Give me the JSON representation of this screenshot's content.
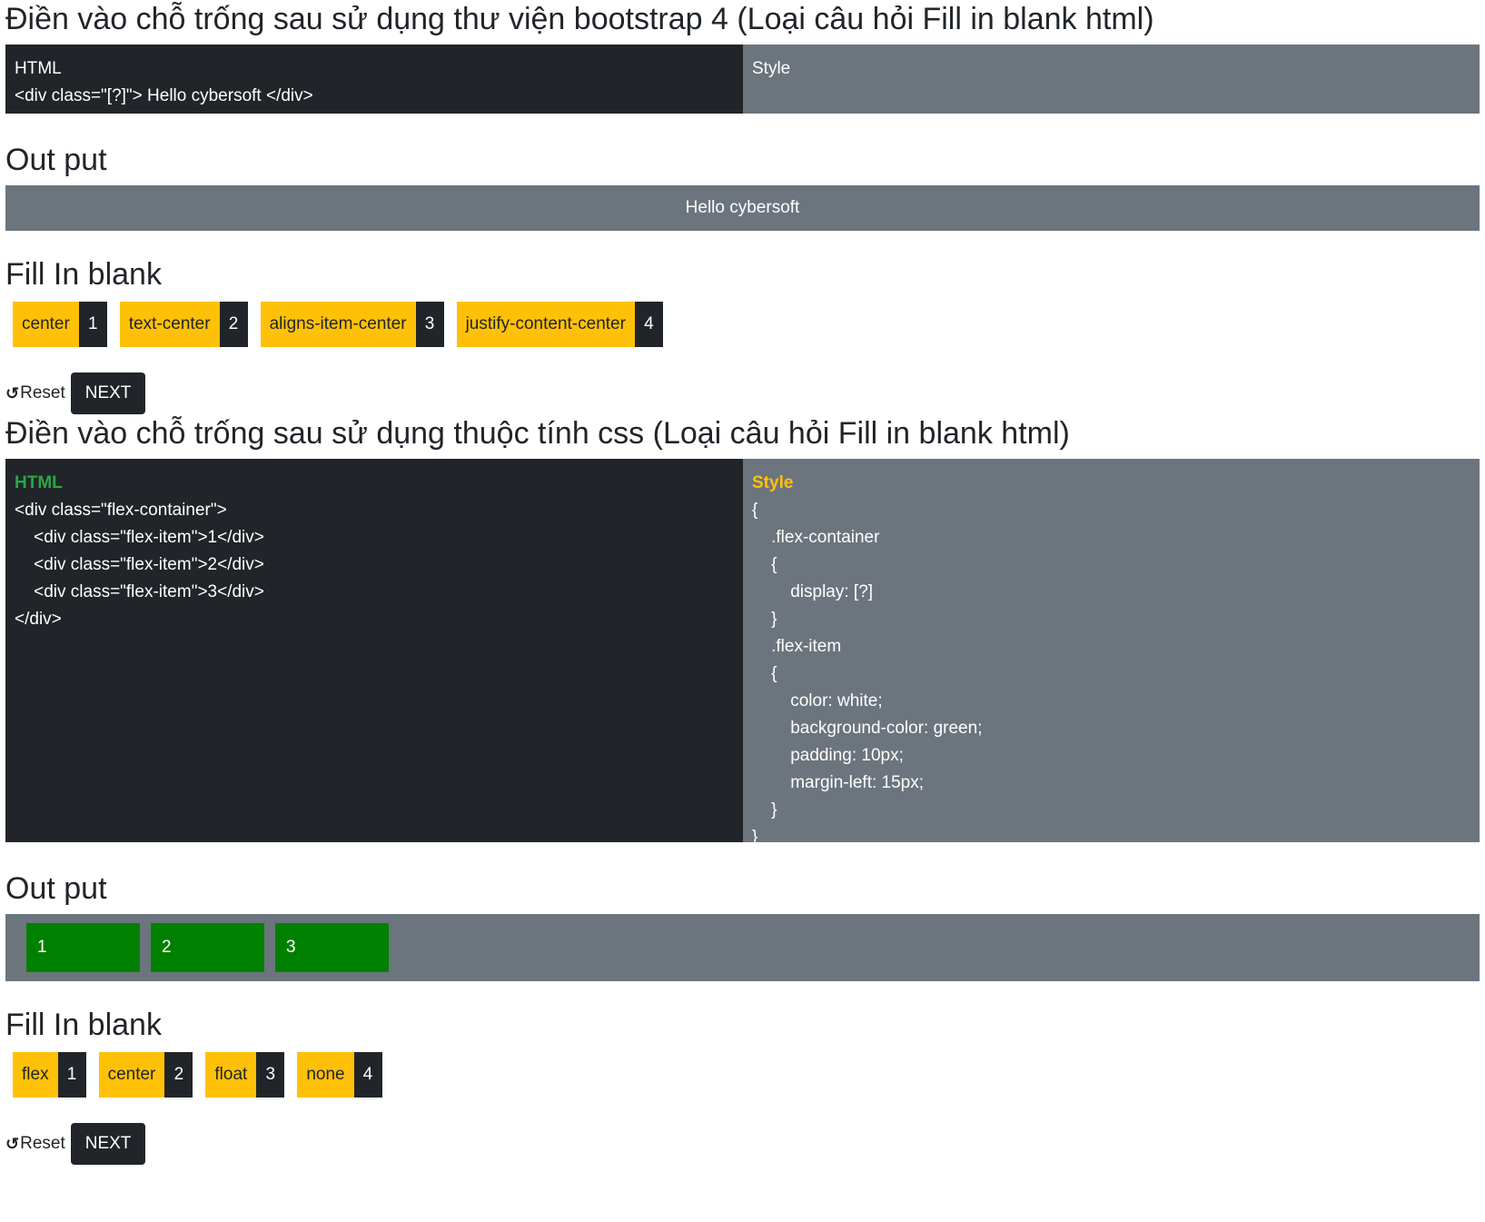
{
  "q1": {
    "title": "Điền vào chỗ trống sau sử dụng thư viện bootstrap 4 (Loại câu hỏi Fill in blank html)",
    "html_header": "HTML",
    "html_lines": [
      "<div class=\"[?]\"> Hello cybersoft </div>"
    ],
    "style_header": "Style",
    "output_title": "Out put",
    "output_text": "Hello cybersoft",
    "blank_title": "Fill In blank",
    "options": [
      {
        "label": "center",
        "num": "1"
      },
      {
        "label": "text-center",
        "num": "2"
      },
      {
        "label": "aligns-item-center",
        "num": "3"
      },
      {
        "label": "justify-content-center",
        "num": "4"
      }
    ],
    "reset_label": "Reset",
    "next_label": "NEXT"
  },
  "q2": {
    "title": "Điền vào chỗ trống sau sử dụng thuộc tính css (Loại câu hỏi Fill in blank html)",
    "html_header": "HTML",
    "html_lines": [
      "<div class=\"flex-container\">",
      "    <div class=\"flex-item\">1</div>",
      "    <div class=\"flex-item\">2</div>",
      "    <div class=\"flex-item\">3</div>",
      "</div>"
    ],
    "style_header": "Style",
    "style_lines": [
      "{",
      "    .flex-container",
      "    {",
      "        display: [?]",
      "    }",
      "    .flex-item",
      "    {",
      "        color: white;",
      "        background-color: green;",
      "        padding: 10px;",
      "        margin-left: 15px;",
      "    }",
      "}"
    ],
    "output_title": "Out put",
    "output_items": [
      "1",
      "2",
      "3"
    ],
    "blank_title": "Fill In blank",
    "options": [
      {
        "label": "flex",
        "num": "1"
      },
      {
        "label": "center",
        "num": "2"
      },
      {
        "label": "float",
        "num": "3"
      },
      {
        "label": "none",
        "num": "4"
      }
    ],
    "reset_label": "Reset",
    "next_label": "NEXT"
  },
  "colors": {
    "dark": "#212529",
    "gray": "#6c757d",
    "yellow": "#ffc107",
    "green": "#008000",
    "html_header_green": "#28a745"
  }
}
